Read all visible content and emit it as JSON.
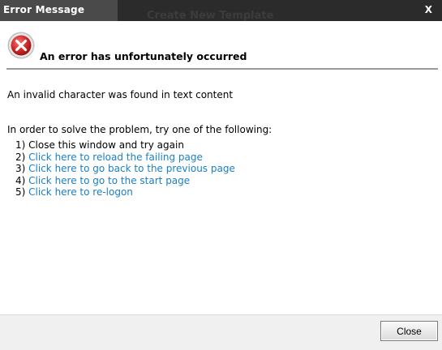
{
  "window": {
    "title": "Error Message",
    "background_title": "Create New Template",
    "close_glyph": "X"
  },
  "error": {
    "icon": "error-x-icon",
    "headline": "An error has unfortunately occurred",
    "message": "An invalid character was found in text content"
  },
  "instructions": "In order to solve the problem, try one of the following:",
  "options": [
    {
      "number": "1)",
      "text": "Close this window and try again",
      "link": false
    },
    {
      "number": "2)",
      "text": "Click here to reload the failing page",
      "link": true
    },
    {
      "number": "3)",
      "text": "Click here to go back to the previous page",
      "link": true
    },
    {
      "number": "4)",
      "text": "Click here to go to the start page",
      "link": true
    },
    {
      "number": "5)",
      "text": "Click here to re-logon",
      "link": true
    }
  ],
  "footer": {
    "close_label": "Close"
  },
  "colors": {
    "titlebar": "#2b2b2b",
    "link": "#1a7fc4",
    "error_red": "#d42a2a"
  }
}
